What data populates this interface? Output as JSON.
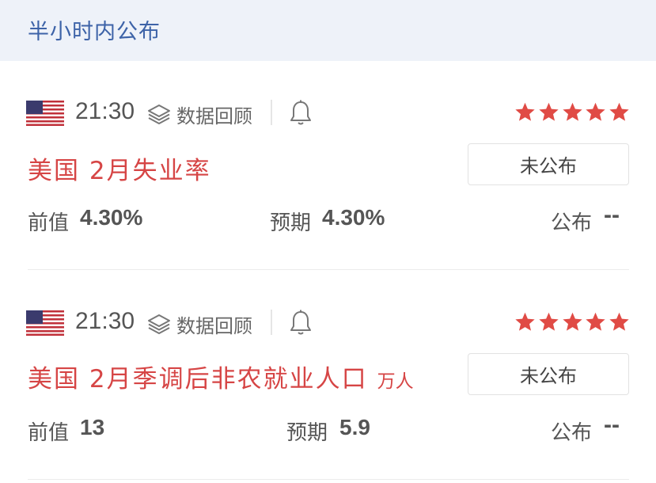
{
  "header": {
    "title": "半小时内公布"
  },
  "events": [
    {
      "time": "21:30",
      "review_label": "数据回顾",
      "flag_icon": "us-flag-icon",
      "stars": 5,
      "title": "美国 2月失业率",
      "unit": "",
      "status": "未公布",
      "prev_label": "前值",
      "prev_value": "4.30%",
      "forecast_label": "预期",
      "forecast_value": "4.30%",
      "publish_label": "公布",
      "publish_value": "--"
    },
    {
      "time": "21:30",
      "review_label": "数据回顾",
      "flag_icon": "us-flag-icon",
      "stars": 5,
      "title": "美国 2月季调后非农就业人口",
      "unit": "万人",
      "status": "未公布",
      "prev_label": "前值",
      "prev_value": "13",
      "forecast_label": "预期",
      "forecast_value": "5.9",
      "publish_label": "公布",
      "publish_value": "--"
    }
  ],
  "colors": {
    "accent_red": "#d64545",
    "header_blue": "#3d63a8",
    "header_bg": "#eef2f9"
  }
}
